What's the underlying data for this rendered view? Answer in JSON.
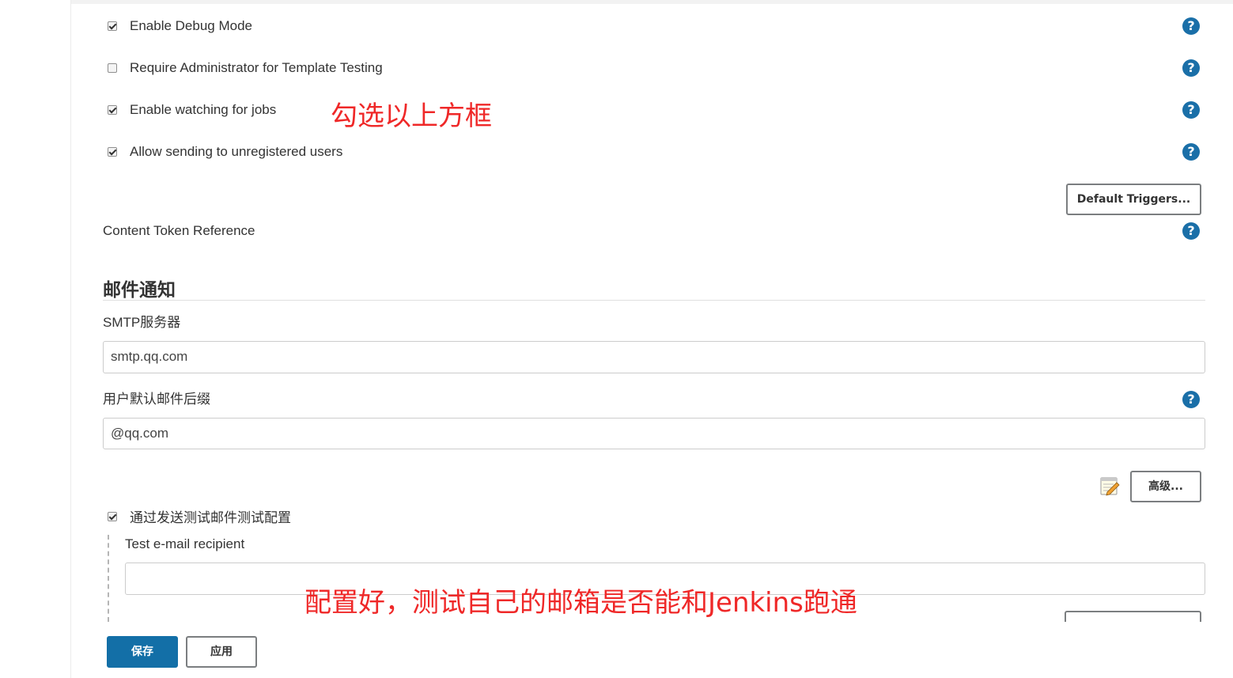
{
  "options": [
    {
      "label": "Enable Debug Mode",
      "checked": true
    },
    {
      "label": "Require Administrator for Template Testing",
      "checked": false
    },
    {
      "label": "Enable watching for jobs",
      "checked": true
    },
    {
      "label": "Allow sending to unregistered users",
      "checked": true
    }
  ],
  "help_glyph": "?",
  "default_triggers_label": "Default Triggers...",
  "content_token_label": "Content Token Reference",
  "email_section": {
    "title": "邮件通知",
    "smtp_label": "SMTP服务器",
    "smtp_value": "smtp.qq.com",
    "suffix_label": "用户默认邮件后缀",
    "suffix_value": "@qq.com",
    "advanced_label": "高级...",
    "test_config_label": "通过发送测试邮件测试配置",
    "test_config_checked": true,
    "test_recipient_label": "Test e-mail recipient",
    "test_recipient_value": ""
  },
  "annotations": {
    "check_boxes_note": "勾选以上方框",
    "test_note": "配置好，测试自己的邮箱是否能和Jenkins跑通"
  },
  "footer": {
    "save_label": "保存",
    "apply_label": "应用"
  },
  "colors": {
    "primary": "#136fa7",
    "help_icon": "#1a6fa8",
    "annotation_red": "#ef2828"
  },
  "icons": {
    "help": "question-circle-icon",
    "notepad": "notepad-icon",
    "checkbox": "checkbox"
  }
}
